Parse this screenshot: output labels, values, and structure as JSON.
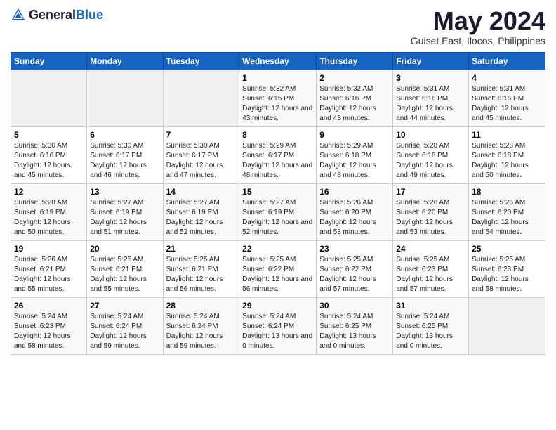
{
  "logo": {
    "text_general": "General",
    "text_blue": "Blue"
  },
  "header": {
    "month": "May 2024",
    "location": "Guiset East, Ilocos, Philippines"
  },
  "weekdays": [
    "Sunday",
    "Monday",
    "Tuesday",
    "Wednesday",
    "Thursday",
    "Friday",
    "Saturday"
  ],
  "weeks": [
    [
      {
        "day": "",
        "sunrise": "",
        "sunset": "",
        "daylight": "",
        "empty": true
      },
      {
        "day": "",
        "sunrise": "",
        "sunset": "",
        "daylight": "",
        "empty": true
      },
      {
        "day": "",
        "sunrise": "",
        "sunset": "",
        "daylight": "",
        "empty": true
      },
      {
        "day": "1",
        "sunrise": "Sunrise: 5:32 AM",
        "sunset": "Sunset: 6:15 PM",
        "daylight": "Daylight: 12 hours and 43 minutes."
      },
      {
        "day": "2",
        "sunrise": "Sunrise: 5:32 AM",
        "sunset": "Sunset: 6:16 PM",
        "daylight": "Daylight: 12 hours and 43 minutes."
      },
      {
        "day": "3",
        "sunrise": "Sunrise: 5:31 AM",
        "sunset": "Sunset: 6:16 PM",
        "daylight": "Daylight: 12 hours and 44 minutes."
      },
      {
        "day": "4",
        "sunrise": "Sunrise: 5:31 AM",
        "sunset": "Sunset: 6:16 PM",
        "daylight": "Daylight: 12 hours and 45 minutes."
      }
    ],
    [
      {
        "day": "5",
        "sunrise": "Sunrise: 5:30 AM",
        "sunset": "Sunset: 6:16 PM",
        "daylight": "Daylight: 12 hours and 45 minutes."
      },
      {
        "day": "6",
        "sunrise": "Sunrise: 5:30 AM",
        "sunset": "Sunset: 6:17 PM",
        "daylight": "Daylight: 12 hours and 46 minutes."
      },
      {
        "day": "7",
        "sunrise": "Sunrise: 5:30 AM",
        "sunset": "Sunset: 6:17 PM",
        "daylight": "Daylight: 12 hours and 47 minutes."
      },
      {
        "day": "8",
        "sunrise": "Sunrise: 5:29 AM",
        "sunset": "Sunset: 6:17 PM",
        "daylight": "Daylight: 12 hours and 48 minutes."
      },
      {
        "day": "9",
        "sunrise": "Sunrise: 5:29 AM",
        "sunset": "Sunset: 6:18 PM",
        "daylight": "Daylight: 12 hours and 48 minutes."
      },
      {
        "day": "10",
        "sunrise": "Sunrise: 5:28 AM",
        "sunset": "Sunset: 6:18 PM",
        "daylight": "Daylight: 12 hours and 49 minutes."
      },
      {
        "day": "11",
        "sunrise": "Sunrise: 5:28 AM",
        "sunset": "Sunset: 6:18 PM",
        "daylight": "Daylight: 12 hours and 50 minutes."
      }
    ],
    [
      {
        "day": "12",
        "sunrise": "Sunrise: 5:28 AM",
        "sunset": "Sunset: 6:19 PM",
        "daylight": "Daylight: 12 hours and 50 minutes."
      },
      {
        "day": "13",
        "sunrise": "Sunrise: 5:27 AM",
        "sunset": "Sunset: 6:19 PM",
        "daylight": "Daylight: 12 hours and 51 minutes."
      },
      {
        "day": "14",
        "sunrise": "Sunrise: 5:27 AM",
        "sunset": "Sunset: 6:19 PM",
        "daylight": "Daylight: 12 hours and 52 minutes."
      },
      {
        "day": "15",
        "sunrise": "Sunrise: 5:27 AM",
        "sunset": "Sunset: 6:19 PM",
        "daylight": "Daylight: 12 hours and 52 minutes."
      },
      {
        "day": "16",
        "sunrise": "Sunrise: 5:26 AM",
        "sunset": "Sunset: 6:20 PM",
        "daylight": "Daylight: 12 hours and 53 minutes."
      },
      {
        "day": "17",
        "sunrise": "Sunrise: 5:26 AM",
        "sunset": "Sunset: 6:20 PM",
        "daylight": "Daylight: 12 hours and 53 minutes."
      },
      {
        "day": "18",
        "sunrise": "Sunrise: 5:26 AM",
        "sunset": "Sunset: 6:20 PM",
        "daylight": "Daylight: 12 hours and 54 minutes."
      }
    ],
    [
      {
        "day": "19",
        "sunrise": "Sunrise: 5:26 AM",
        "sunset": "Sunset: 6:21 PM",
        "daylight": "Daylight: 12 hours and 55 minutes."
      },
      {
        "day": "20",
        "sunrise": "Sunrise: 5:25 AM",
        "sunset": "Sunset: 6:21 PM",
        "daylight": "Daylight: 12 hours and 55 minutes."
      },
      {
        "day": "21",
        "sunrise": "Sunrise: 5:25 AM",
        "sunset": "Sunset: 6:21 PM",
        "daylight": "Daylight: 12 hours and 56 minutes."
      },
      {
        "day": "22",
        "sunrise": "Sunrise: 5:25 AM",
        "sunset": "Sunset: 6:22 PM",
        "daylight": "Daylight: 12 hours and 56 minutes."
      },
      {
        "day": "23",
        "sunrise": "Sunrise: 5:25 AM",
        "sunset": "Sunset: 6:22 PM",
        "daylight": "Daylight: 12 hours and 57 minutes."
      },
      {
        "day": "24",
        "sunrise": "Sunrise: 5:25 AM",
        "sunset": "Sunset: 6:23 PM",
        "daylight": "Daylight: 12 hours and 57 minutes."
      },
      {
        "day": "25",
        "sunrise": "Sunrise: 5:25 AM",
        "sunset": "Sunset: 6:23 PM",
        "daylight": "Daylight: 12 hours and 58 minutes."
      }
    ],
    [
      {
        "day": "26",
        "sunrise": "Sunrise: 5:24 AM",
        "sunset": "Sunset: 6:23 PM",
        "daylight": "Daylight: 12 hours and 58 minutes."
      },
      {
        "day": "27",
        "sunrise": "Sunrise: 5:24 AM",
        "sunset": "Sunset: 6:24 PM",
        "daylight": "Daylight: 12 hours and 59 minutes."
      },
      {
        "day": "28",
        "sunrise": "Sunrise: 5:24 AM",
        "sunset": "Sunset: 6:24 PM",
        "daylight": "Daylight: 12 hours and 59 minutes."
      },
      {
        "day": "29",
        "sunrise": "Sunrise: 5:24 AM",
        "sunset": "Sunset: 6:24 PM",
        "daylight": "Daylight: 13 hours and 0 minutes."
      },
      {
        "day": "30",
        "sunrise": "Sunrise: 5:24 AM",
        "sunset": "Sunset: 6:25 PM",
        "daylight": "Daylight: 13 hours and 0 minutes."
      },
      {
        "day": "31",
        "sunrise": "Sunrise: 5:24 AM",
        "sunset": "Sunset: 6:25 PM",
        "daylight": "Daylight: 13 hours and 0 minutes."
      },
      {
        "day": "",
        "sunrise": "",
        "sunset": "",
        "daylight": "",
        "empty": true
      }
    ]
  ]
}
